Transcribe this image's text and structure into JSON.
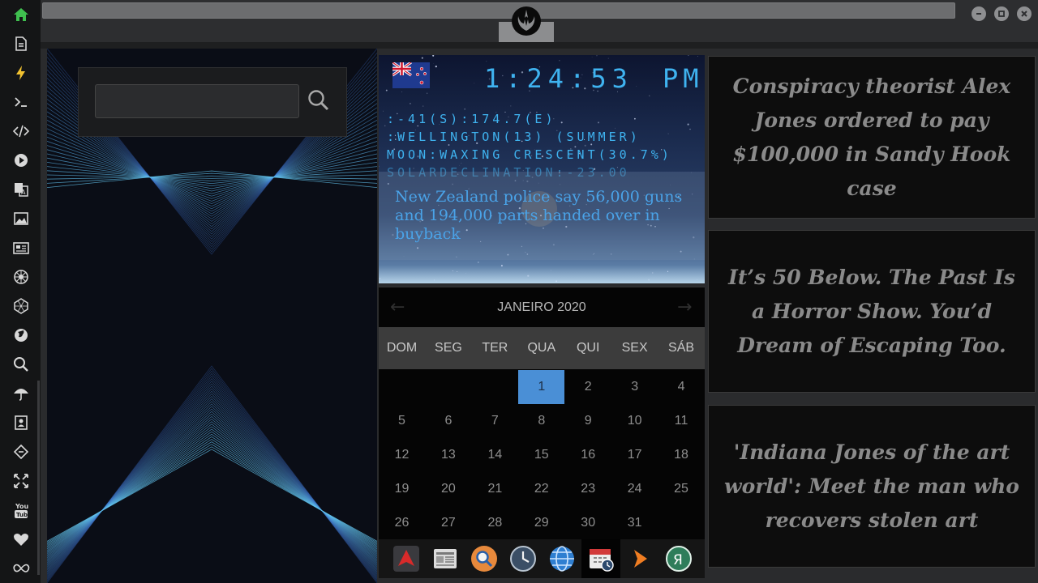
{
  "sidebar": {
    "items": [
      {
        "name": "home-icon"
      },
      {
        "name": "document-icon"
      },
      {
        "name": "lightning-icon"
      },
      {
        "name": "terminal-icon"
      },
      {
        "name": "code-icon"
      },
      {
        "name": "play-icon"
      },
      {
        "name": "translate-icon"
      },
      {
        "name": "image-icon"
      },
      {
        "name": "news-icon"
      },
      {
        "name": "empire-icon"
      },
      {
        "name": "hexagon-icon"
      },
      {
        "name": "globe-icon"
      },
      {
        "name": "search-icon"
      },
      {
        "name": "umbrella-icon"
      },
      {
        "name": "contacts-icon"
      },
      {
        "name": "diamond-code-icon"
      },
      {
        "name": "fullscreen-icon"
      },
      {
        "name": "youtube-icon"
      },
      {
        "name": "heart-icon"
      },
      {
        "name": "infinity-icon"
      }
    ],
    "accent": "#3fbf4f"
  },
  "search": {
    "placeholder": ""
  },
  "clock": {
    "time": "1:24:53",
    "ampm": "PM",
    "coords": ":-41(S):174.7(E)",
    "location": ":WELLINGTON(13) (SUMMER)",
    "moon": "MOON:WAXING CRESCENT(30.7%)",
    "solar": "SOLARDECLINATION:-23.00",
    "color": "#3fb3f0"
  },
  "news_overlay": {
    "headline": "New Zealand police say 56,000 guns and 194,000 parts handed over in buyback"
  },
  "calendar": {
    "title": "JANEIRO 2020",
    "days": [
      "DOM",
      "SEG",
      "TER",
      "QUA",
      "QUI",
      "SEX",
      "SÁB"
    ],
    "weeks": [
      [
        "",
        "",
        "",
        "1",
        "2",
        "3",
        "4"
      ],
      [
        "5",
        "6",
        "7",
        "8",
        "9",
        "10",
        "11"
      ],
      [
        "12",
        "13",
        "14",
        "15",
        "16",
        "17",
        "18"
      ],
      [
        "19",
        "20",
        "21",
        "22",
        "23",
        "24",
        "25"
      ],
      [
        "26",
        "27",
        "28",
        "29",
        "30",
        "31",
        ""
      ]
    ],
    "today": "1",
    "today_color": "#4a8fd6"
  },
  "dock": {
    "items": [
      {
        "name": "arch-app-icon"
      },
      {
        "name": "newspaper-app-icon"
      },
      {
        "name": "search-app-icon"
      },
      {
        "name": "clock-app-icon"
      },
      {
        "name": "browser-globe-icon"
      },
      {
        "name": "calendar-app-icon"
      },
      {
        "name": "arrow-app-icon"
      },
      {
        "name": "yandex-app-icon"
      }
    ]
  },
  "news": [
    {
      "headline": "Conspiracy theorist Alex Jones ordered to pay $100,000 in Sandy Hook case"
    },
    {
      "headline": "It’s 50 Below. The Past Is a Horror Show. You’d Dream of Escaping Too."
    },
    {
      "headline": "'Indiana Jones of the art world': Meet the man who recovers stolen art"
    }
  ]
}
